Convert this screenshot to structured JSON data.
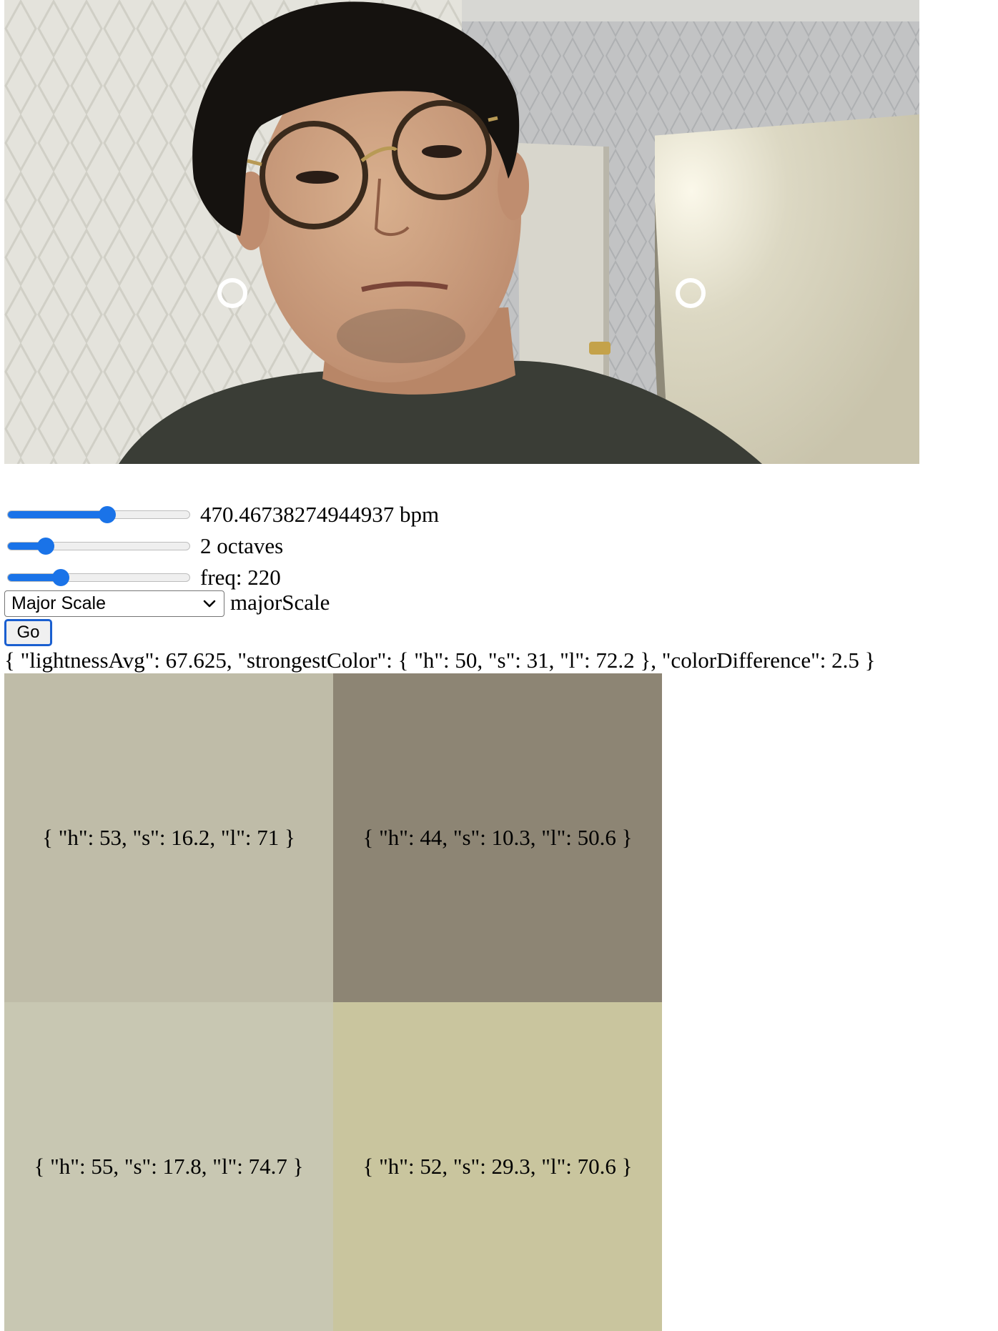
{
  "video": {
    "markers": [
      "circle-marker-left",
      "circle-marker-right"
    ]
  },
  "controls": {
    "tempo": {
      "slider_value_fraction": 0.55,
      "label": "470.46738274944937 bpm"
    },
    "octaves": {
      "slider_value_fraction": 0.18,
      "label": "2 octaves"
    },
    "freq": {
      "slider_value_fraction": 0.27,
      "label": "freq: 220"
    },
    "scale": {
      "selected_option": "Major Scale",
      "value_label": "majorScale"
    },
    "go_label": "Go"
  },
  "analysis_text": "{ \"lightnessAvg\": 67.625, \"strongestColor\": { \"h\": 50, \"s\": 31, \"l\": 72.2 }, \"colorDifference\": 2.5 }",
  "swatches": [
    {
      "label": "{ \"h\": 53, \"s\": 16.2, \"l\": 71 }",
      "color": "#bfbca8"
    },
    {
      "label": "{ \"h\": 44, \"s\": 10.3, \"l\": 50.6 }",
      "color": "#8d8574"
    },
    {
      "label": "{ \"h\": 55, \"s\": 17.8, \"l\": 74.7 }",
      "color": "#c8c7b2"
    },
    {
      "label": "{ \"h\": 52, \"s\": 29.3, \"l\": 70.6 }",
      "color": "#c9c59e"
    }
  ],
  "colors": {
    "accent": "#1a73e8"
  }
}
